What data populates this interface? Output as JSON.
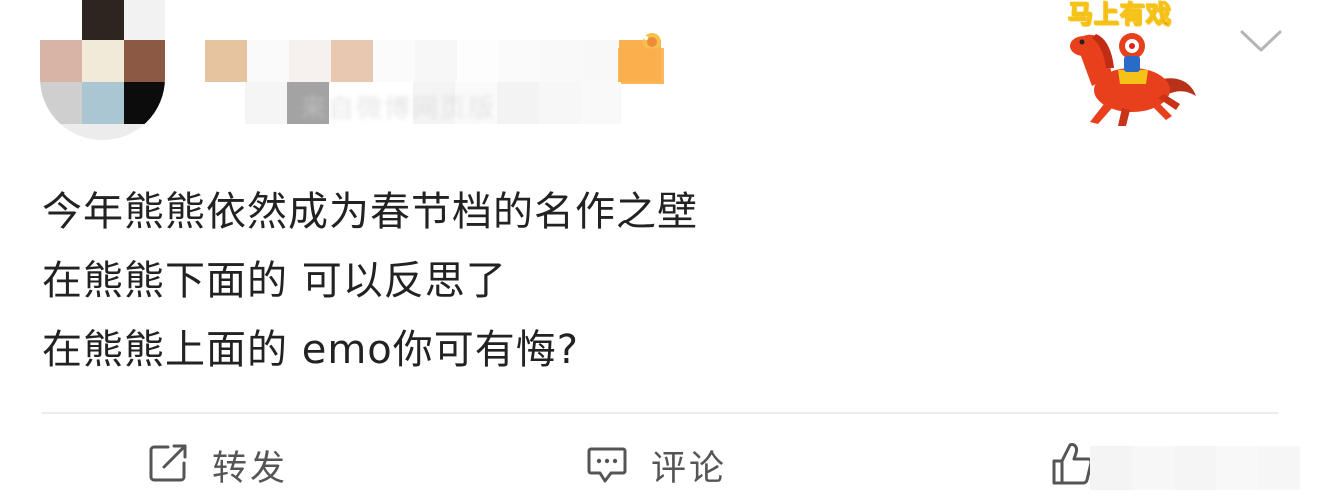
{
  "post": {
    "source_text": "来自微博网页版",
    "sticker_label": "马上有戏",
    "content_lines": [
      "今年熊熊依然成为春节档的名作之壁",
      "在熊熊下面的 可以反思了",
      "在熊熊上面的 emo你可有悔?"
    ]
  },
  "actions": {
    "repost_label": "转发",
    "comment_label": "评论"
  },
  "colors": {
    "text": "#222222",
    "action_text": "#555555",
    "divider": "#ececec",
    "sticker_text": "#e02020",
    "horse": "#e8401c"
  },
  "icons": [
    "repost-icon",
    "comment-icon",
    "like-icon",
    "chevron-down-icon",
    "vip-badge-icon"
  ]
}
